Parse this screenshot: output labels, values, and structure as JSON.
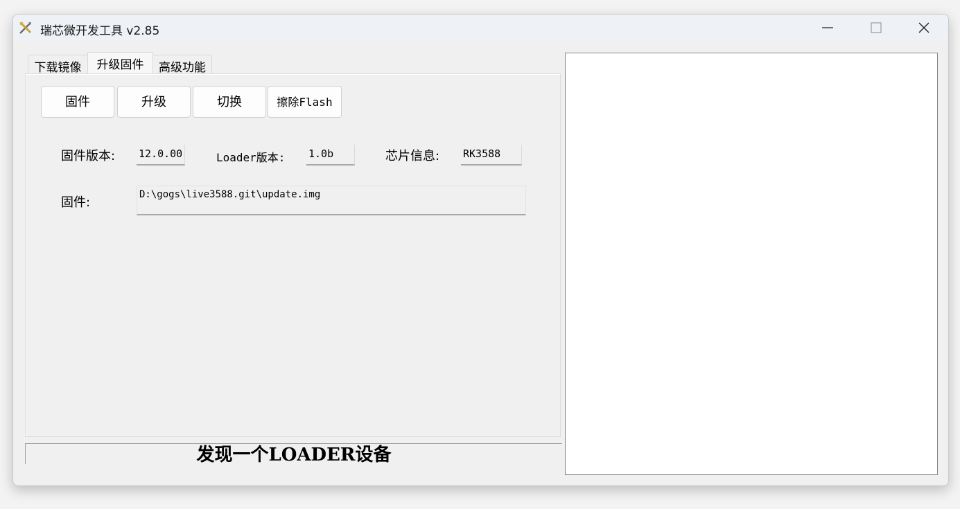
{
  "window": {
    "title": "瑞芯微开发工具 v2.85",
    "icon": "tools-icon"
  },
  "tabs": [
    {
      "label": "下载镜像",
      "active": false
    },
    {
      "label": "升级固件",
      "active": true
    },
    {
      "label": "高级功能",
      "active": false
    }
  ],
  "toolbar": {
    "firmware_label": "固件",
    "upgrade_label": "升级",
    "switch_label": "切换",
    "erase_label": "擦除Flash"
  },
  "info": {
    "fw_version_label": "固件版本:",
    "fw_version_value": "12.0.00",
    "loader_version_label": "Loader版本:",
    "loader_version_value": "1.0b",
    "chip_info_label": "芯片信息:",
    "chip_info_value": "RK3588",
    "firmware_label": "固件:",
    "firmware_path": "D:\\gogs\\live3588.git\\update.img"
  },
  "status": {
    "text": "发现一个LOADER设备"
  },
  "log": {
    "content": ""
  }
}
